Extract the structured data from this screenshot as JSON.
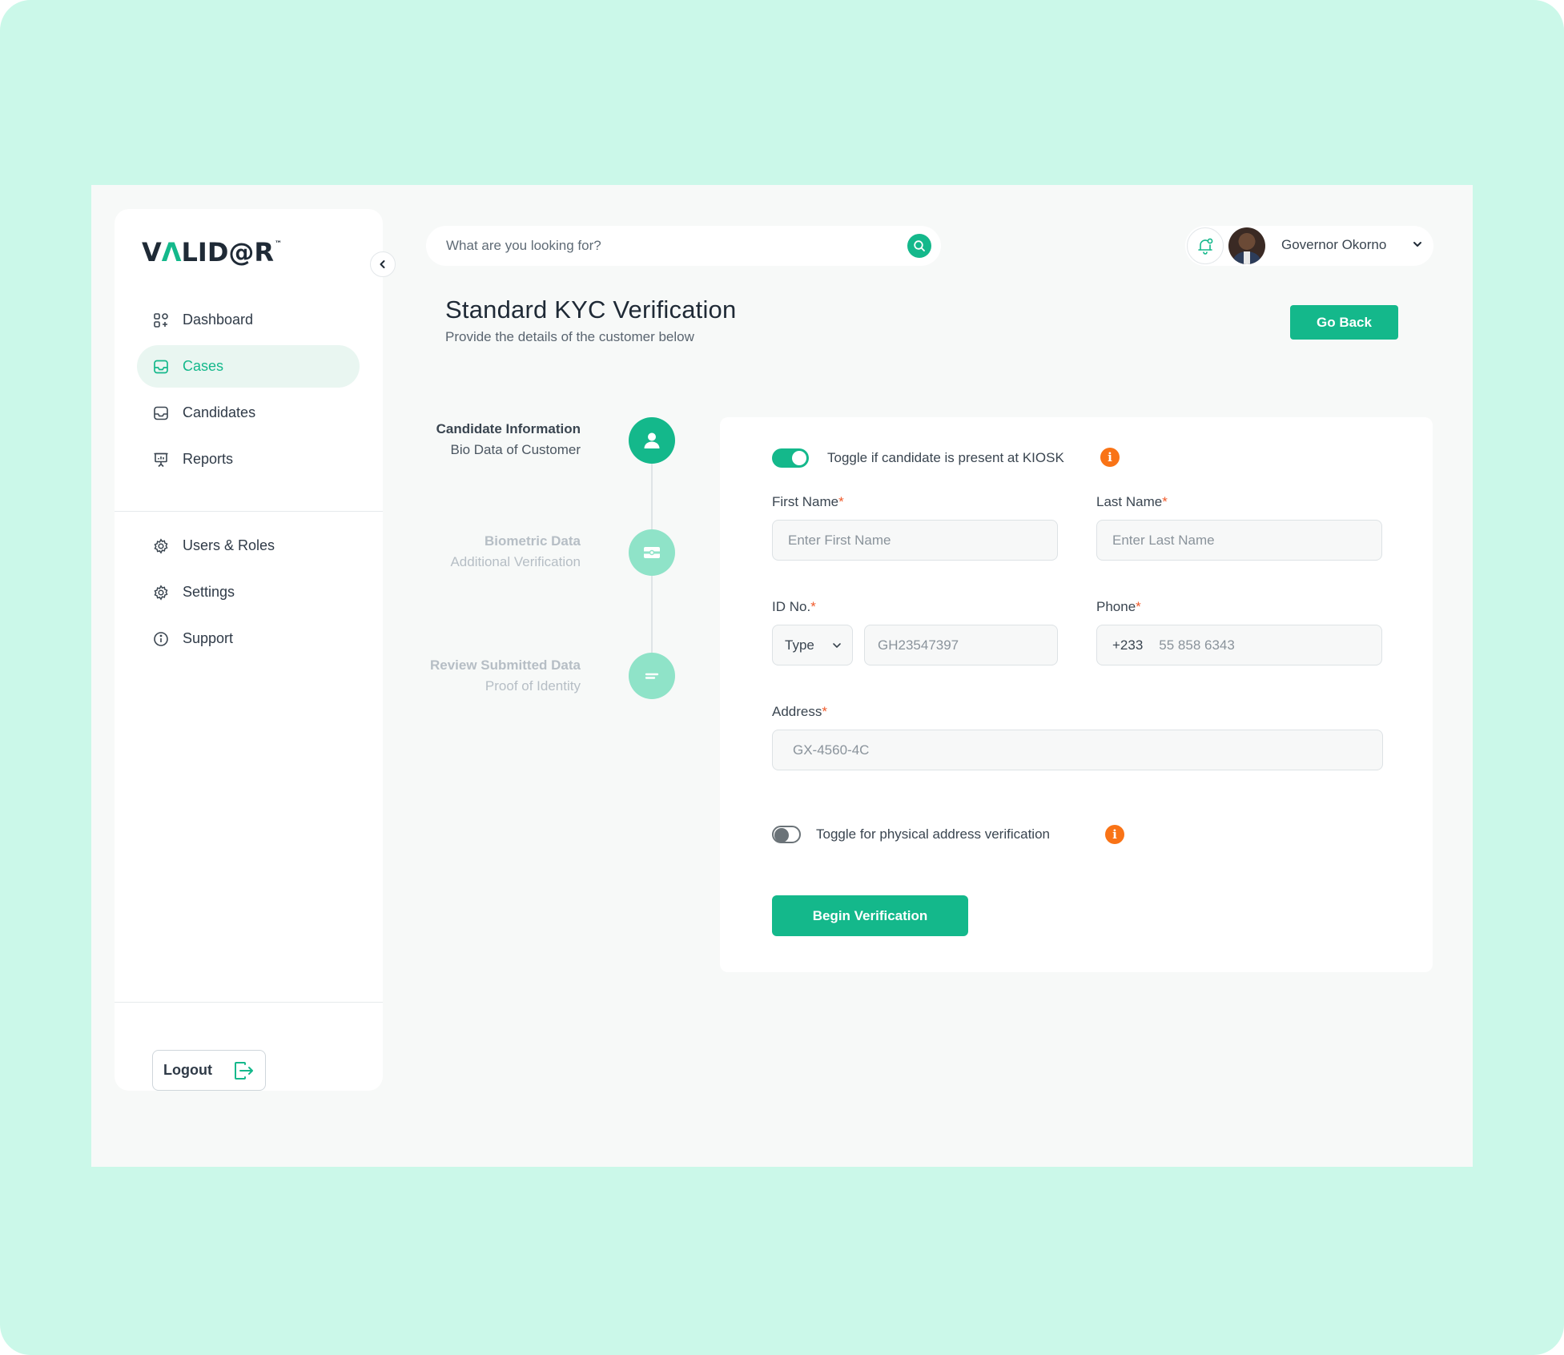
{
  "brand": {
    "logo_pre": "V",
    "logo_accent": "Λ",
    "logo_post": "LID@R",
    "logo_tm": "™"
  },
  "sidebar": {
    "items": [
      {
        "label": "Dashboard",
        "icon": "grid-icon",
        "active": false
      },
      {
        "label": "Cases",
        "icon": "inbox-icon",
        "active": true
      },
      {
        "label": "Candidates",
        "icon": "inbox-icon",
        "active": false
      },
      {
        "label": "Reports",
        "icon": "presentation-chart-icon",
        "active": false
      }
    ],
    "secondary_items": [
      {
        "label": "Users & Roles",
        "icon": "gear-icon"
      },
      {
        "label": "Settings",
        "icon": "gear-icon"
      },
      {
        "label": "Support",
        "icon": "info-icon"
      }
    ],
    "logout_label": "Logout"
  },
  "topbar": {
    "search_placeholder": "What are you looking for?",
    "user_name": "Governor Okorno"
  },
  "header": {
    "title": "Standard KYC Verification",
    "subtitle": "Provide the details of the customer below",
    "go_back_label": "Go Back"
  },
  "stepper": [
    {
      "title": "Candidate Information",
      "subtitle": "Bio Data of Customer",
      "state": "active",
      "icon": "user-icon"
    },
    {
      "title": "Biometric Data",
      "subtitle": "Additional Verification",
      "state": "inactive",
      "icon": "id-card-icon"
    },
    {
      "title": "Review Submitted Data",
      "subtitle": "Proof of Identity",
      "state": "inactive",
      "icon": "list-icon"
    }
  ],
  "form": {
    "kiosk_toggle_label": "Toggle if candidate is present at KIOSK",
    "kiosk_toggle_on": true,
    "first_name_label": "First Name",
    "first_name_placeholder": "Enter First Name",
    "last_name_label": "Last Name",
    "last_name_placeholder": "Enter Last Name",
    "id_label": "ID No.",
    "id_type_value": "Type",
    "id_number_placeholder": "GH23547397",
    "phone_label": "Phone",
    "phone_prefix": "+233",
    "phone_placeholder": "55 858 6343",
    "address_label": "Address",
    "address_placeholder": "GX-4560-4C",
    "address_toggle_label": "Toggle for physical address verification",
    "address_toggle_on": false,
    "required_mark": "*",
    "info_mark": "i",
    "begin_label": "Begin Verification"
  },
  "colors": {
    "accent": "#14b88b",
    "background": "#cbf8e9",
    "warning": "#f97316"
  }
}
